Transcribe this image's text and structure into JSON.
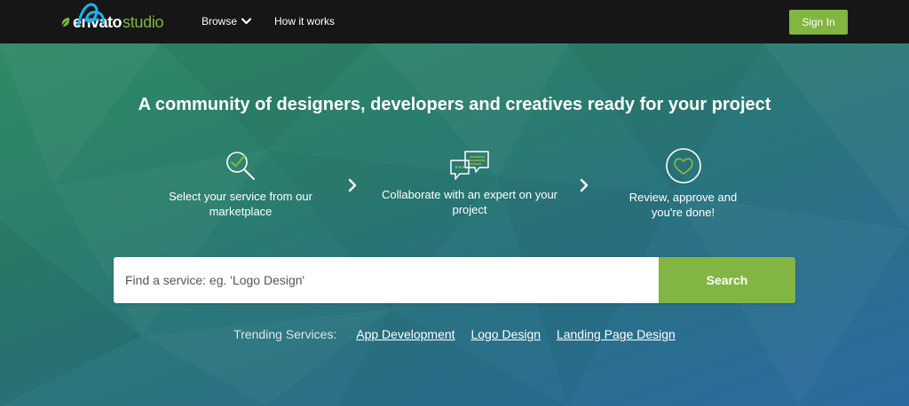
{
  "nav": {
    "logo_envato": "envato",
    "logo_studio": "studio",
    "browse_label": "Browse",
    "how_label": "How it works",
    "signin_label": "Sign In"
  },
  "hero": {
    "headline": "A community of designers, developers and creatives ready for your project",
    "steps": [
      {
        "icon": "search-check-icon",
        "label": "Select your service from our marketplace"
      },
      {
        "icon": "chat-bubbles-icon",
        "label": "Collaborate with an expert on your project"
      },
      {
        "icon": "heart-circle-icon",
        "label": "Review, approve and you're done!"
      }
    ],
    "search": {
      "placeholder": "Find a service: eg. 'Logo Design'",
      "value": "",
      "button_label": "Search"
    },
    "trending": {
      "label": "Trending Services:",
      "links": [
        "App Development",
        "Logo Design",
        "Landing Page Design"
      ]
    }
  },
  "colors": {
    "nav_bg": "#161616",
    "accent_green": "#82b541",
    "hero_start": "#2e8a64",
    "hero_end": "#2b6aa0"
  }
}
